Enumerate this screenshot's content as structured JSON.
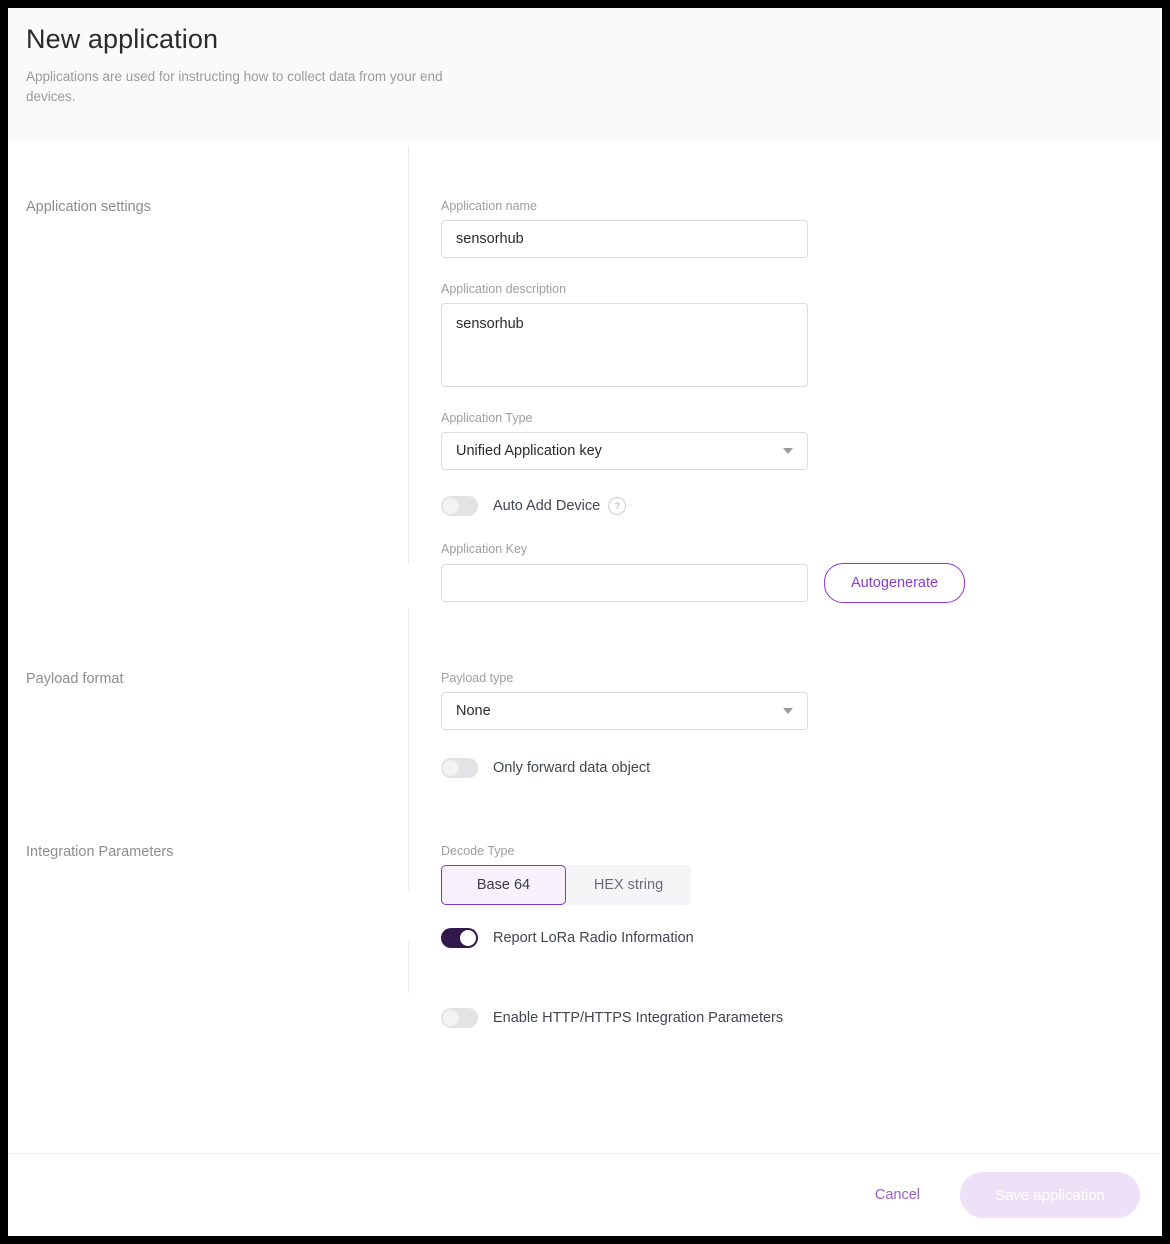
{
  "header": {
    "title": "New application",
    "subtitle": "Applications are used for instructing how to collect data from your end devices."
  },
  "sections": {
    "application_settings": {
      "label": "Application settings",
      "fields": {
        "app_name": {
          "label": "Application name",
          "value": "sensorhub",
          "placeholder": ""
        },
        "app_description": {
          "label": "Application description",
          "value": "sensorhub",
          "placeholder": ""
        },
        "app_type": {
          "label": "Application Type",
          "value": "Unified Application key",
          "options": [
            "Unified Application key"
          ]
        },
        "auto_add_device": {
          "label": "Auto Add Device",
          "state": "off",
          "help": "?"
        },
        "app_key": {
          "label": "Application Key",
          "value": "",
          "placeholder": ""
        }
      },
      "autogenerate_button": "Autogenerate"
    },
    "payload_format": {
      "label": "Payload format",
      "fields": {
        "payload_type": {
          "label": "Payload type",
          "value": "None",
          "options": [
            "None"
          ]
        },
        "only_forward_data_object": {
          "label": "Only forward data object",
          "state": "off"
        }
      }
    },
    "integration_parameters": {
      "label": "Integration Parameters",
      "fields": {
        "decode_type": {
          "label": "Decode Type",
          "options": [
            "Base 64",
            "HEX string"
          ],
          "selected": "Base 64"
        },
        "report_lora_radio_information": {
          "label": "Report LoRa Radio Information",
          "state": "on"
        },
        "enable_http_integration": {
          "label": "Enable HTTP/HTTPS Integration Parameters",
          "state": "off"
        }
      }
    }
  },
  "footer": {
    "cancel_label": "Cancel",
    "save_label": "Save application",
    "save_disabled": true
  },
  "colors": {
    "accent_purple": "#8b3cd8",
    "toggle_on": "#30194a",
    "segment_active_bg": "#f7f1fb",
    "segment_active_border": "#7c3bbd",
    "save_disabled_bg": "#eee0f7",
    "header_bg": "#fafafa"
  }
}
